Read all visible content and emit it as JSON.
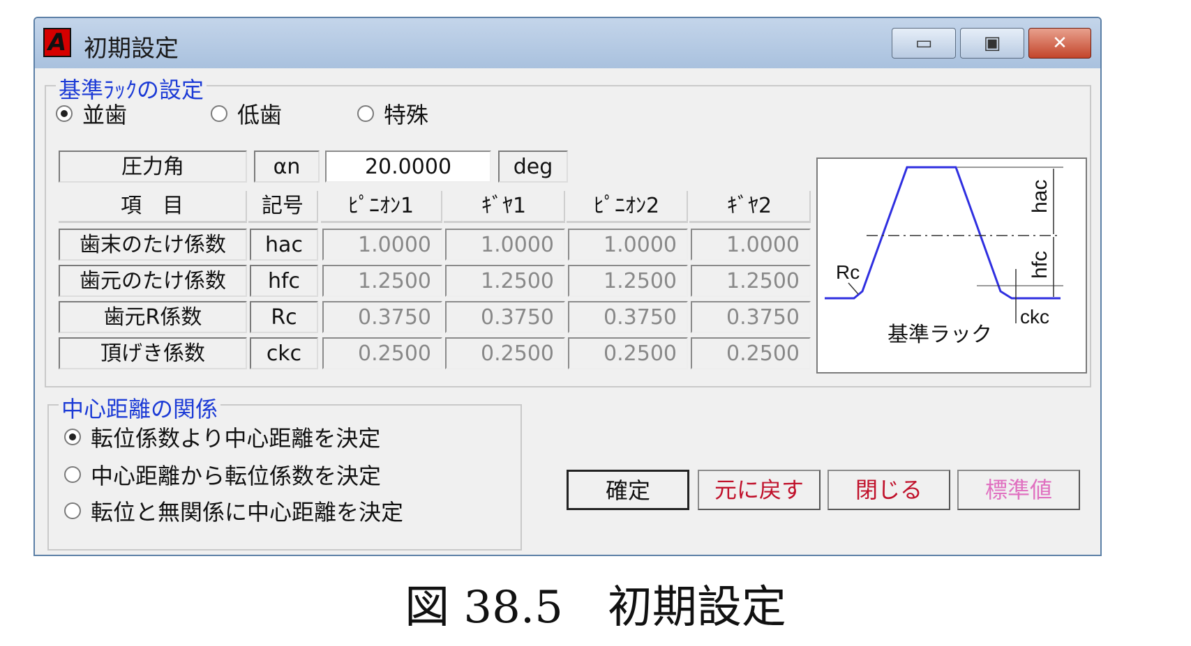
{
  "window": {
    "title": "初期設定",
    "app_icon": "A",
    "minimize_glyph": "▭",
    "maximize_glyph": "▣",
    "close_glyph": "✕"
  },
  "rack_group": {
    "title": "基準ﾗｯｸの設定",
    "options": [
      {
        "label": "並歯",
        "selected": true
      },
      {
        "label": "低歯",
        "selected": false
      },
      {
        "label": "特殊",
        "selected": false
      }
    ],
    "pressure": {
      "label": "圧力角",
      "symbol": "αn",
      "value": "20.0000",
      "unit": "deg"
    },
    "headers": [
      "項　目",
      "記号",
      "ﾋﾟﾆｵﾝ1",
      "ｷﾞﾔ1",
      "ﾋﾟﾆｵﾝ2",
      "ｷﾞﾔ2"
    ],
    "rows": [
      {
        "name": "歯末のたけ係数",
        "symbol": "hac",
        "values": [
          "1.0000",
          "1.0000",
          "1.0000",
          "1.0000"
        ]
      },
      {
        "name": "歯元のたけ係数",
        "symbol": "hfc",
        "values": [
          "1.2500",
          "1.2500",
          "1.2500",
          "1.2500"
        ]
      },
      {
        "name": "歯元R係数",
        "symbol": "Rc",
        "values": [
          "0.3750",
          "0.3750",
          "0.3750",
          "0.3750"
        ]
      },
      {
        "name": "頂げき係数",
        "symbol": "ckc",
        "values": [
          "0.2500",
          "0.2500",
          "0.2500",
          "0.2500"
        ]
      }
    ],
    "diagram": {
      "caption": "基準ラック",
      "label_hac": "hac",
      "label_hfc": "hfc",
      "label_rc": "Rc",
      "label_ckc": "ckc"
    }
  },
  "center_group": {
    "title": "中心距離の関係",
    "options": [
      {
        "label": "転位係数より中心距離を決定",
        "selected": true
      },
      {
        "label": "中心距離から転位係数を決定",
        "selected": false
      },
      {
        "label": "転位と無関係に中心距離を決定",
        "selected": false
      }
    ]
  },
  "buttons": {
    "confirm": "確定",
    "revert": "元に戻す",
    "close": "閉じる",
    "standard": "標準値"
  },
  "colors": {
    "group_title": "#1c3bd6",
    "revert": "#c0102a",
    "standard": "#e070c0",
    "diagram_line": "#2f2fe0"
  },
  "caption": "図 38.5　初期設定"
}
